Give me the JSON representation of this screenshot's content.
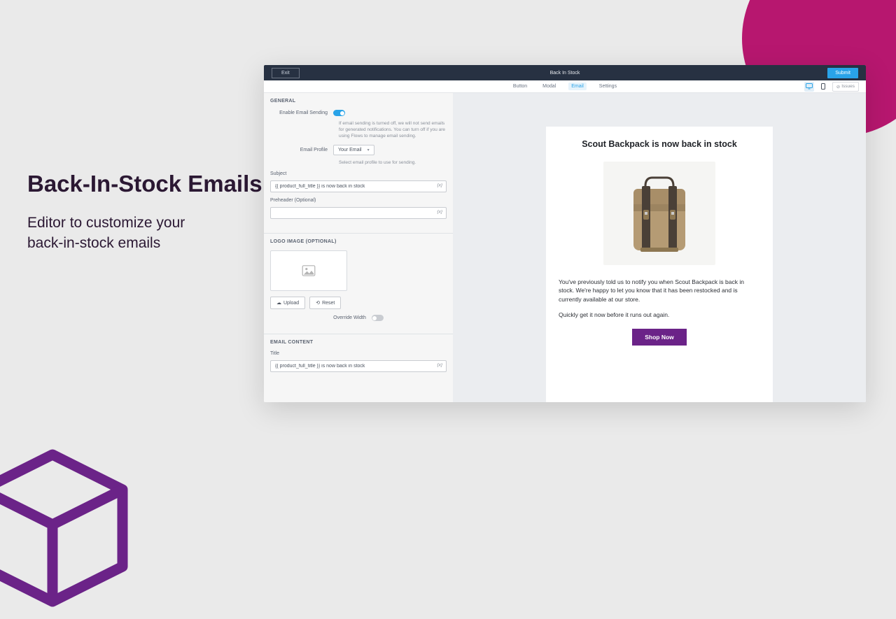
{
  "hero": {
    "title": "Back-In-Stock Emails",
    "subtitle_line1": "Editor to customize your",
    "subtitle_line2": "back-in-stock emails"
  },
  "header": {
    "exit": "Exit",
    "title": "Back In Stock",
    "submit": "Submit"
  },
  "tabs": {
    "button": "Button",
    "modal": "Modal",
    "email": "Email",
    "settings": "Settings",
    "issues": "Issues"
  },
  "sidebar": {
    "general": {
      "header": "GENERAL",
      "enable_label": "Enable Email Sending",
      "enable_help": "If email sending is turned off, we will not send emails for generated notifications. You can turn off if you are using Flows to manage email sending.",
      "profile_label": "Email Profile",
      "profile_value": "Your Email",
      "profile_help": "Select email profile to use for sending.",
      "subject_label": "Subject",
      "subject_value": "{{ product_full_title }} is now back in stock",
      "preheader_label": "Preheader (Optional)",
      "input_suffix": "{x}"
    },
    "logo": {
      "header": "LOGO IMAGE (OPTIONAL)",
      "upload": "Upload",
      "reset": "Reset",
      "override_label": "Override Width"
    },
    "content": {
      "header": "EMAIL CONTENT",
      "title_label": "Title",
      "title_value": "{{ product_full_title }} is now back in stock"
    }
  },
  "preview": {
    "title": "Scout Backpack is now back in stock",
    "body1": "You've previously told us to notify you when Scout Backpack is back in stock. We're happy to let you know that it has been restocked and is currently available at our store.",
    "body2": "Quickly get it now before it runs out again.",
    "cta": "Shop Now"
  }
}
